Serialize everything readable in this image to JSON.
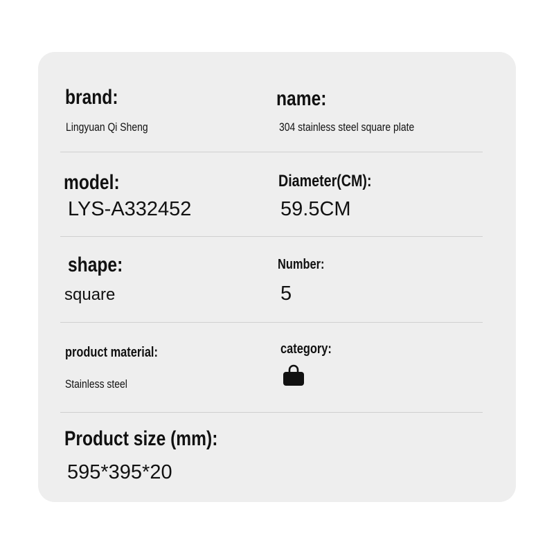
{
  "specs": {
    "brand": {
      "label": "brand:",
      "value": "Lingyuan Qi Sheng"
    },
    "name": {
      "label": "name:",
      "value": "304 stainless steel square plate"
    },
    "model": {
      "label": "model:",
      "value": "LYS-A332452"
    },
    "diameter": {
      "label": "Diameter(CM):",
      "value": "59.5CM"
    },
    "shape": {
      "label": "shape:",
      "value": "square"
    },
    "number": {
      "label": "Number:",
      "value": "5"
    },
    "material": {
      "label": "product material:",
      "value": "Stainless steel"
    },
    "category": {
      "label": "category:",
      "icon": "shopping-bag-icon"
    },
    "size": {
      "label": "Product size (mm):",
      "value": "595*395*20"
    }
  },
  "colors": {
    "card_background": "#eeeeee",
    "divider": "#cfcfcf",
    "text": "#111111"
  }
}
